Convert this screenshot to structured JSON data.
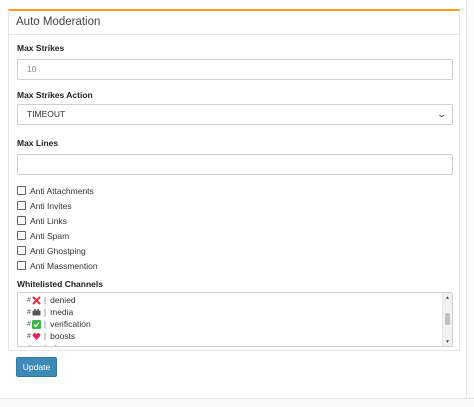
{
  "card": {
    "title": "Auto Moderation"
  },
  "max_strikes": {
    "label": "Max Strikes",
    "placeholder": "10"
  },
  "max_strikes_action": {
    "label": "Max Strikes Action",
    "selected": "TIMEOUT"
  },
  "max_lines": {
    "label": "Max Lines",
    "value": ""
  },
  "checkboxes": [
    {
      "label": "Anti Attachments",
      "checked": false
    },
    {
      "label": "Anti Invites",
      "checked": false
    },
    {
      "label": "Anti Links",
      "checked": false
    },
    {
      "label": "Anti Spam",
      "checked": false
    },
    {
      "label": "Anti Ghostping",
      "checked": false
    },
    {
      "label": "Anti Massmention",
      "checked": false
    }
  ],
  "whitelisted": {
    "label": "Whitelisted Channels",
    "channels": [
      {
        "hash": "#",
        "icon": "cross-mark-icon",
        "name": "denied"
      },
      {
        "hash": "#",
        "icon": "film-camera-icon",
        "name": "media"
      },
      {
        "hash": "#",
        "icon": "check-mark-icon",
        "name": "verification"
      },
      {
        "hash": "#",
        "icon": "hearts-icon",
        "name": "boosts"
      },
      {
        "hash": "#",
        "icon": "gift-icon",
        "name": "giveaway"
      }
    ]
  },
  "update_button": {
    "label": "Update"
  },
  "colors": {
    "accent": "#f0a020",
    "button": "#3d8ab8"
  }
}
